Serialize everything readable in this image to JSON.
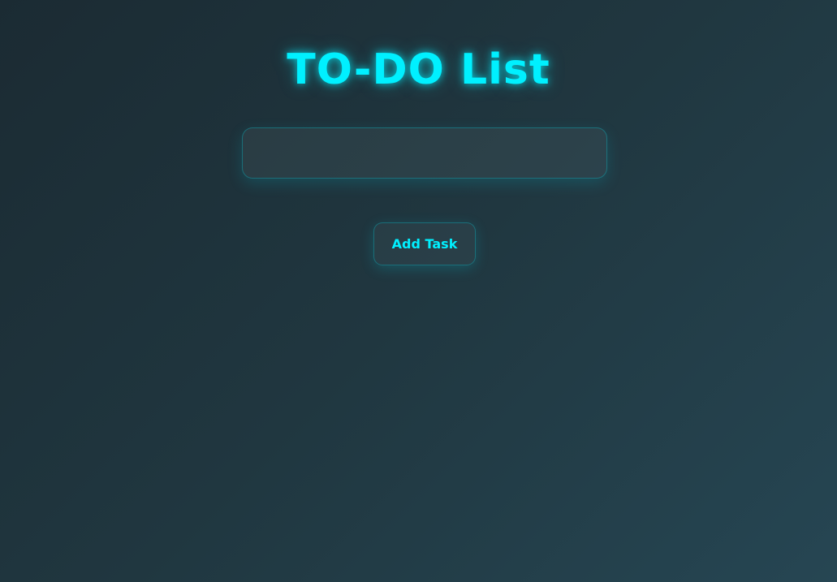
{
  "app": {
    "title": "TO-DO List"
  },
  "task_input": {
    "value": "",
    "placeholder": ""
  },
  "actions": {
    "add_label": "Add Task"
  },
  "colors": {
    "accent": "#00f0ff",
    "background_start": "#1b2b33",
    "background_end": "#264653"
  }
}
